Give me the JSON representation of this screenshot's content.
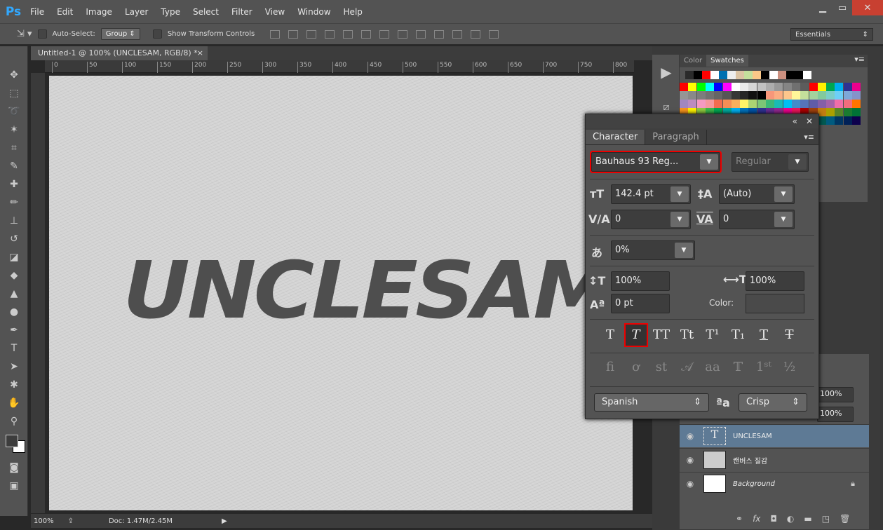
{
  "app": {
    "logo": "Ps",
    "menu": [
      "File",
      "Edit",
      "Image",
      "Layer",
      "Type",
      "Select",
      "Filter",
      "View",
      "Window",
      "Help"
    ],
    "window_controls": [
      "minimize",
      "maximize",
      "close"
    ]
  },
  "options": {
    "auto_select_label": "Auto-Select:",
    "auto_select_value": "Group",
    "transform_label": "Show Transform Controls",
    "workspace": "Essentials"
  },
  "document": {
    "tab_title": "Untitled-1 @ 100% (UNCLESAM, RGB/8) *",
    "close": "×",
    "canvas_text": "UNCLESAM",
    "ruler_labels": [
      "0",
      "50",
      "100",
      "150",
      "200",
      "250",
      "300",
      "350",
      "400",
      "450",
      "500",
      "550",
      "600",
      "650",
      "700",
      "750",
      "800"
    ],
    "zoom": "100%",
    "doc_info": "Doc: 1.47M/2.45M"
  },
  "tools": [
    "move",
    "marquee",
    "lasso",
    "magic-wand",
    "crop",
    "eyedropper",
    "healing",
    "brush",
    "stamp",
    "history-brush",
    "eraser",
    "bucket",
    "blur",
    "dodge",
    "pen",
    "type",
    "path-select",
    "shape",
    "hand",
    "zoom"
  ],
  "swatches": {
    "tabs": [
      "Color",
      "Swatches"
    ],
    "active": 1,
    "recent": [
      "#2b2b2b",
      "#000000",
      "#ff0000",
      "#ffffff",
      "#0070b0",
      "#eeeeee",
      "#dcc4a4",
      "#c4e09c",
      "#fcc888",
      "#000000",
      "#ffffff",
      "#cc9080",
      "#000000",
      "#000000",
      "#ffffff"
    ],
    "rows": [
      [
        "#ff0000",
        "#ffff00",
        "#00ff00",
        "#00ffff",
        "#0000ff",
        "#ff00ff",
        "#ffffff",
        "#ebebeb",
        "#d6d6d6",
        "#c2c2c2",
        "#adadad",
        "#999999",
        "#858585",
        "#707070",
        "#5c5c5c",
        "#ff0000",
        "#fff100",
        "#00a651",
        "#00aeef",
        "#2e3192",
        "#ec008c"
      ],
      [
        "#959595",
        "#898989",
        "#7d7d7d",
        "#717171",
        "#656565",
        "#555555",
        "#363636",
        "#262626",
        "#111111",
        "#000000",
        "#f7977a",
        "#fbad82",
        "#fdc68c",
        "#fff799",
        "#c4df9b",
        "#a3d39c",
        "#82ca9c",
        "#7bcdc8",
        "#6ecff6",
        "#7ea7d8",
        "#8493ca"
      ],
      [
        "#a187be",
        "#bc8cbf",
        "#f49ac1",
        "#f5989d",
        "#f26c4f",
        "#f68e56",
        "#fbaf5d",
        "#fff467",
        "#acd373",
        "#7cc576",
        "#3bb878",
        "#1abbb4",
        "#00bff3",
        "#438ccb",
        "#5574b9",
        "#605ca8",
        "#855fa8",
        "#a763a8",
        "#f06ea9",
        "#f26d7d",
        "#ff7400"
      ],
      [
        "#f7941d",
        "#fff200",
        "#8dc73f",
        "#39b54a",
        "#00a651",
        "#00a99d",
        "#00aeef",
        "#0072bc",
        "#0054a6",
        "#2e3192",
        "#662d91",
        "#92278f",
        "#ec008c",
        "#ed145b",
        "#aa0000",
        "#a0410d",
        "#c17d11",
        "#aba000",
        "#598527",
        "#1a7b30",
        "#007236"
      ],
      [
        "#00746b",
        "#0076a3",
        "#004b80",
        "#003471",
        "#1b1464",
        "#440e62",
        "#630460",
        "#9e005d",
        "#9e0039",
        "#790000",
        "#7b2e00",
        "#7d4900",
        "#827b00",
        "#406618",
        "#005e20",
        "#005826",
        "#005952",
        "#005b7f",
        "#003663",
        "#002157",
        "#0d004c"
      ]
    ]
  },
  "character": {
    "tabs": [
      "Character",
      "Paragraph"
    ],
    "font_family": "Bauhaus 93 Reg...",
    "font_style": "Regular",
    "size": "142.4 pt",
    "leading": "(Auto)",
    "kerning": "0",
    "tracking": "0",
    "tsume": "0%",
    "vertical_scale": "100%",
    "horizontal_scale": "100%",
    "baseline_shift": "0 pt",
    "color_label": "Color:",
    "color": "#3d3d3d",
    "language": "Spanish",
    "antialias": "Crisp",
    "aa_icon": "ªa",
    "type_styles": [
      "T",
      "T",
      "TT",
      "Tt",
      "T¹",
      "T₁",
      "T",
      "T"
    ],
    "type_style_names": [
      "faux-bold",
      "faux-italic",
      "all-caps",
      "small-caps",
      "superscript",
      "subscript",
      "underline",
      "strikethrough"
    ],
    "active_style": 1,
    "opentype": [
      "ﬁ",
      "ơ",
      "st",
      "𝒜",
      "aa",
      "𝕋",
      "1ˢᵗ",
      "½"
    ],
    "highlight": "#e01010"
  },
  "layers": {
    "opacity": "100%",
    "fill": "100%",
    "items": [
      {
        "name": "UNCLESAM",
        "type": "text",
        "selected": true
      },
      {
        "name": "캔버스 질감",
        "type": "smart-object",
        "selected": false
      },
      {
        "name": "Background",
        "type": "background",
        "locked": true,
        "selected": false
      }
    ],
    "footer_icons": [
      "link-icon",
      "fx-icon",
      "mask-icon",
      "adjustment-icon",
      "folder-icon",
      "new-layer-icon",
      "trash-icon"
    ]
  }
}
